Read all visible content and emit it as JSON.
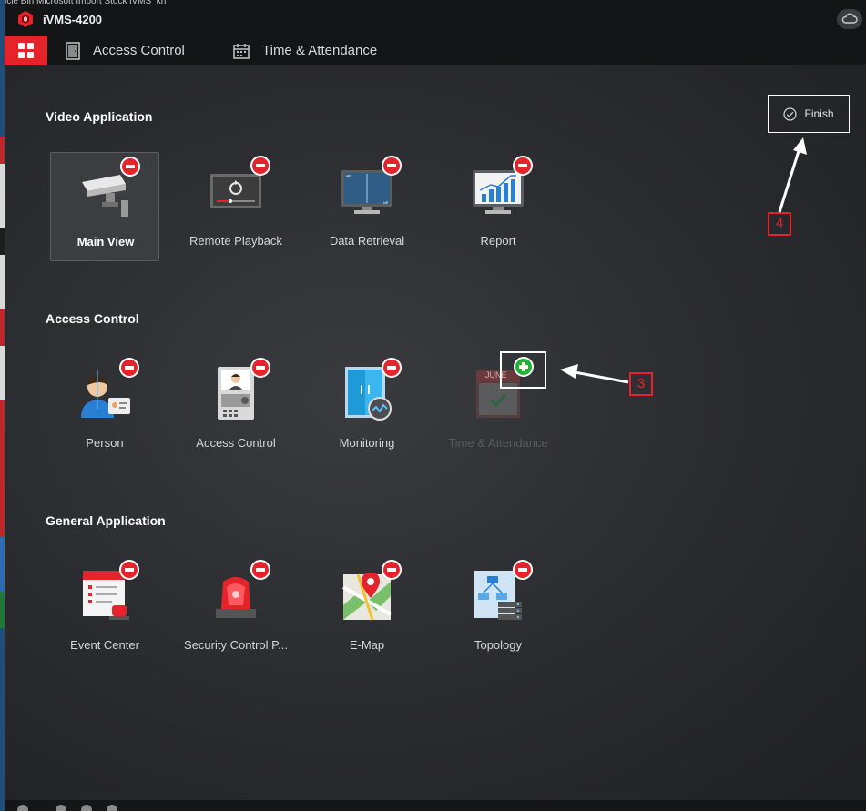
{
  "window": {
    "title": "iVMS-4200",
    "top_bleed_text": "icle Bin     Microsoft    Import Stock    iVMS_kh"
  },
  "tabs": [
    {
      "label": "Access Control",
      "icon": "door-icon"
    },
    {
      "label": "Time & Attendance",
      "icon": "calendar-icon"
    }
  ],
  "finish": {
    "label": "Finish"
  },
  "sections": [
    {
      "title": "Video Application",
      "items": [
        {
          "label": "Main View",
          "icon": "camera-icon",
          "state": "selected"
        },
        {
          "label": "Remote Playback",
          "icon": "playback-icon",
          "state": "added"
        },
        {
          "label": "Data Retrieval",
          "icon": "monitor-icon",
          "state": "added"
        },
        {
          "label": "Report",
          "icon": "bar-report-icon",
          "state": "added"
        }
      ]
    },
    {
      "title": "Access Control",
      "items": [
        {
          "label": "Person",
          "icon": "person-icon",
          "state": "added"
        },
        {
          "label": "Access Control",
          "icon": "intercom-icon",
          "state": "added"
        },
        {
          "label": "Monitoring",
          "icon": "door-monitor-icon",
          "state": "added"
        },
        {
          "label": "Time & Attendance",
          "icon": "calendar-icon",
          "state": "disabled",
          "calendar_month": "JUNE"
        }
      ]
    },
    {
      "title": "General Application",
      "items": [
        {
          "label": "Event Center",
          "icon": "event-icon",
          "state": "added"
        },
        {
          "label": "Security Control P...",
          "icon": "alarm-light-icon",
          "state": "added"
        },
        {
          "label": "E-Map",
          "icon": "map-icon",
          "state": "added"
        },
        {
          "label": "Topology",
          "icon": "topology-icon",
          "state": "added"
        }
      ]
    }
  ],
  "annotations": [
    {
      "label": "3"
    },
    {
      "label": "4"
    }
  ],
  "colors": {
    "accent": "#e4232a",
    "add": "#1fb233",
    "background": "#252628",
    "titlebar": "#141517"
  }
}
